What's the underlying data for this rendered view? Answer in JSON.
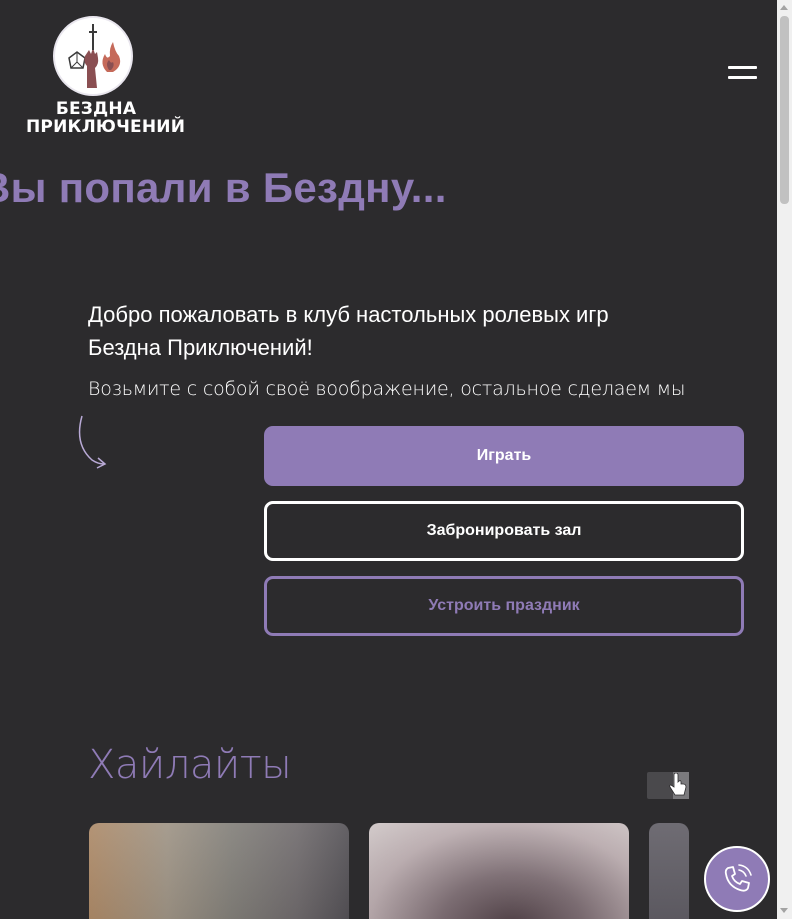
{
  "header": {
    "logo_line1": "БЕЗДНА",
    "logo_line2": "ПРИКЛЮЧЕНИЙ",
    "menu_icon": "hamburger-menu-icon"
  },
  "hero": {
    "headline": "Вы попали в Бездну...",
    "welcome": "Добро пожаловать в клуб настольных ролевых игр Бездна Приключений!",
    "subline": "Возьмите с собой своё воображение, остальное сделаем мы"
  },
  "actions": {
    "play_label": "Играть",
    "book_label": "Забронировать зал",
    "party_label": "Устроить праздник"
  },
  "highlights": {
    "title": "Хайлайты",
    "swipe_icon": "swipe-hand-icon",
    "cards": [
      "card-1",
      "card-2",
      "card-3"
    ]
  },
  "call_widget": {
    "icon": "phone-icon"
  },
  "colors": {
    "background": "#2c2b2d",
    "accent": "#8f7bb6",
    "text": "#ffffff"
  }
}
